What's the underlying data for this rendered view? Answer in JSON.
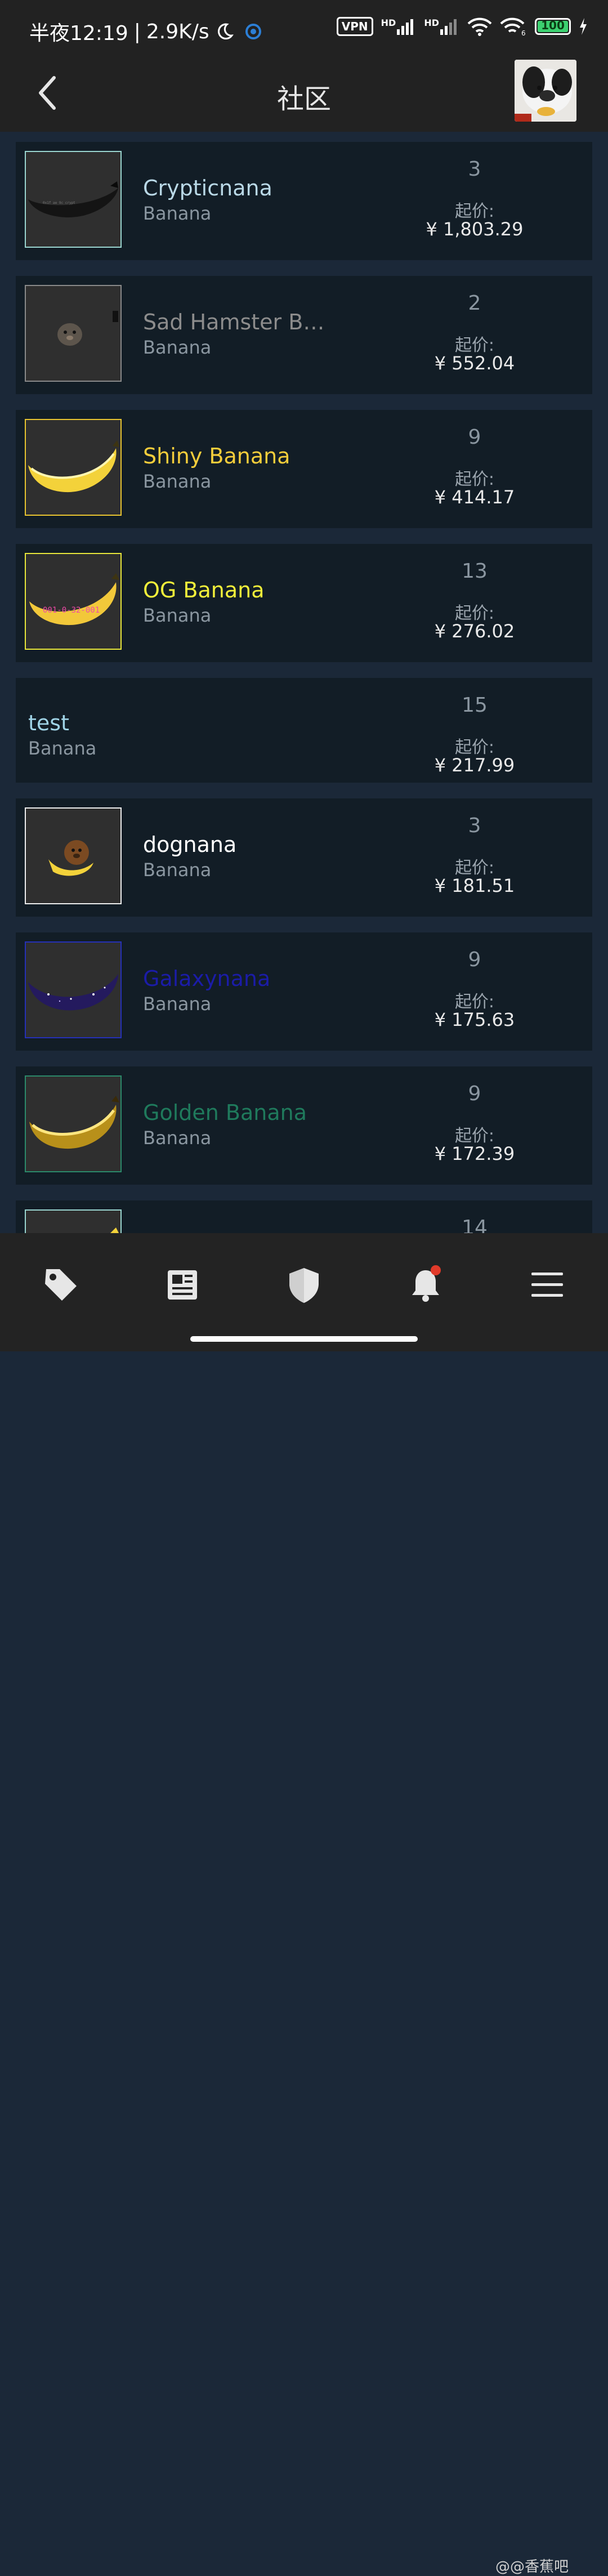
{
  "status_bar": {
    "time": "半夜12:19",
    "speed": "2.9K/s",
    "vpn": "VPN",
    "hd1": "HD",
    "hd2": "HD",
    "battery": "100",
    "battery_level": 1.0
  },
  "header": {
    "title": "社区"
  },
  "price_label": "起价:",
  "items": [
    {
      "name": "Crypticnana",
      "category": "Banana",
      "quantity": "3",
      "price": "¥ 1,803.29",
      "name_color": "#b9d8e6",
      "border_color": "#9ad6d0",
      "thumb": "dark-banana"
    },
    {
      "name": "Sad Hamster B…",
      "category": "Banana",
      "quantity": "2",
      "price": "¥ 552.04",
      "name_color": "#8c8c8c",
      "border_color": "#8a8a8a",
      "thumb": "hamster"
    },
    {
      "name": "Shiny Banana",
      "category": "Banana",
      "quantity": "9",
      "price": "¥ 414.17",
      "name_color": "#f5cd3b",
      "border_color": "#e8c430",
      "thumb": "yellow-banana"
    },
    {
      "name": "OG Banana",
      "category": "Banana",
      "quantity": "13",
      "price": "¥ 276.02",
      "name_color": "#f3f03a",
      "border_color": "#e8e63a",
      "thumb": "og-banana"
    },
    {
      "name": "test",
      "category": "Banana",
      "quantity": "15",
      "price": "¥ 217.99",
      "name_color": "#9fd3e6",
      "border_color": "",
      "thumb": ""
    },
    {
      "name": "dognana",
      "category": "Banana",
      "quantity": "3",
      "price": "¥ 181.51",
      "name_color": "#ffffff",
      "border_color": "#eeeeee",
      "thumb": "dog-banana"
    },
    {
      "name": "Galaxynana",
      "category": "Banana",
      "quantity": "9",
      "price": "¥ 175.63",
      "name_color": "#1b1ca8",
      "border_color": "#2530b8",
      "thumb": "galaxy-banana"
    },
    {
      "name": "Golden Banana",
      "category": "Banana",
      "quantity": "9",
      "price": "¥ 172.39",
      "name_color": "#1f7a5c",
      "border_color": "#2b8a6a",
      "thumb": "golden-banana"
    },
    {
      "name": "",
      "category": "",
      "quantity": "14",
      "price": "",
      "name_color": "#ffffff",
      "border_color": "#9ad6d0",
      "thumb": "partial"
    }
  ],
  "bottom_nav": [
    {
      "icon": "tag-icon"
    },
    {
      "icon": "news-icon"
    },
    {
      "icon": "shield-icon"
    },
    {
      "icon": "bell-icon",
      "badge": true
    },
    {
      "icon": "menu-icon"
    }
  ],
  "watermark": "@@香蕉吧"
}
